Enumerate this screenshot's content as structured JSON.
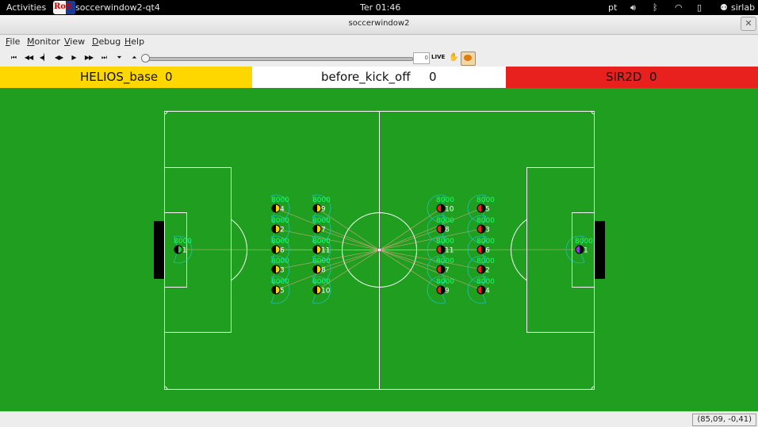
{
  "topbar": {
    "activities": "Activities",
    "app_name": "soccerwindow2-qt4",
    "clock": "Ter 01:46",
    "lang": "pt",
    "user": "sirlab",
    "icons": [
      "volume-icon",
      "bluetooth-icon",
      "wifi-icon",
      "battery-icon",
      "user-icon"
    ]
  },
  "window": {
    "title": "soccerwindow2",
    "close_symbol": "✕"
  },
  "menu": [
    "File",
    "Monitor",
    "View",
    "Debug",
    "Help"
  ],
  "toolbar": {
    "buttons": [
      "go-first",
      "step-back-many",
      "step-back",
      "play-back",
      "play",
      "step-forward",
      "step-forward-many",
      "go-last",
      "drop-down",
      "upload"
    ],
    "cycle": "0",
    "live_label": "LIVE",
    "slider_position": 0
  },
  "scoreboard": {
    "left_team": "HELIOS_base",
    "left_score": "0",
    "play_mode": "before_kick_off",
    "play_mode_score": "0",
    "right_team": "SIR2D",
    "right_score": "0",
    "colors": {
      "left": "#ffd700",
      "center": "#ffffff",
      "right": "#e8211e"
    }
  },
  "field": {
    "background": "#1f9e1f",
    "line_color": "#ffffff",
    "ball_lines_color": "#ffaa99",
    "stamina_color": "#1aff6a",
    "left_team": {
      "body_color": "#ffd700",
      "goalie_color": "#22cc33",
      "players": [
        {
          "unum": "1",
          "stamina": "8000"
        },
        {
          "unum": "2",
          "stamina": "8000"
        },
        {
          "unum": "3",
          "stamina": "8000"
        },
        {
          "unum": "4",
          "stamina": "8000"
        },
        {
          "unum": "5",
          "stamina": "8000"
        },
        {
          "unum": "6",
          "stamina": "8000"
        },
        {
          "unum": "7",
          "stamina": "8000"
        },
        {
          "unum": "8",
          "stamina": "8000"
        },
        {
          "unum": "9",
          "stamina": "8000"
        },
        {
          "unum": "10",
          "stamina": "8000"
        },
        {
          "unum": "11",
          "stamina": "8000"
        }
      ]
    },
    "right_team": {
      "body_color": "#e8211e",
      "goalie_color": "#9933dd",
      "players": [
        {
          "unum": "1",
          "stamina": "8000"
        },
        {
          "unum": "2",
          "stamina": "8000"
        },
        {
          "unum": "3",
          "stamina": "8000"
        },
        {
          "unum": "4",
          "stamina": "8000"
        },
        {
          "unum": "5",
          "stamina": "8000"
        },
        {
          "unum": "6",
          "stamina": "8000"
        },
        {
          "unum": "7",
          "stamina": "8000"
        },
        {
          "unum": "8",
          "stamina": "8000"
        },
        {
          "unum": "9",
          "stamina": "8000"
        },
        {
          "unum": "10",
          "stamina": "8000"
        },
        {
          "unum": "11",
          "stamina": "8000"
        }
      ]
    }
  },
  "status": {
    "coords": "(85,09, -0,41)"
  }
}
